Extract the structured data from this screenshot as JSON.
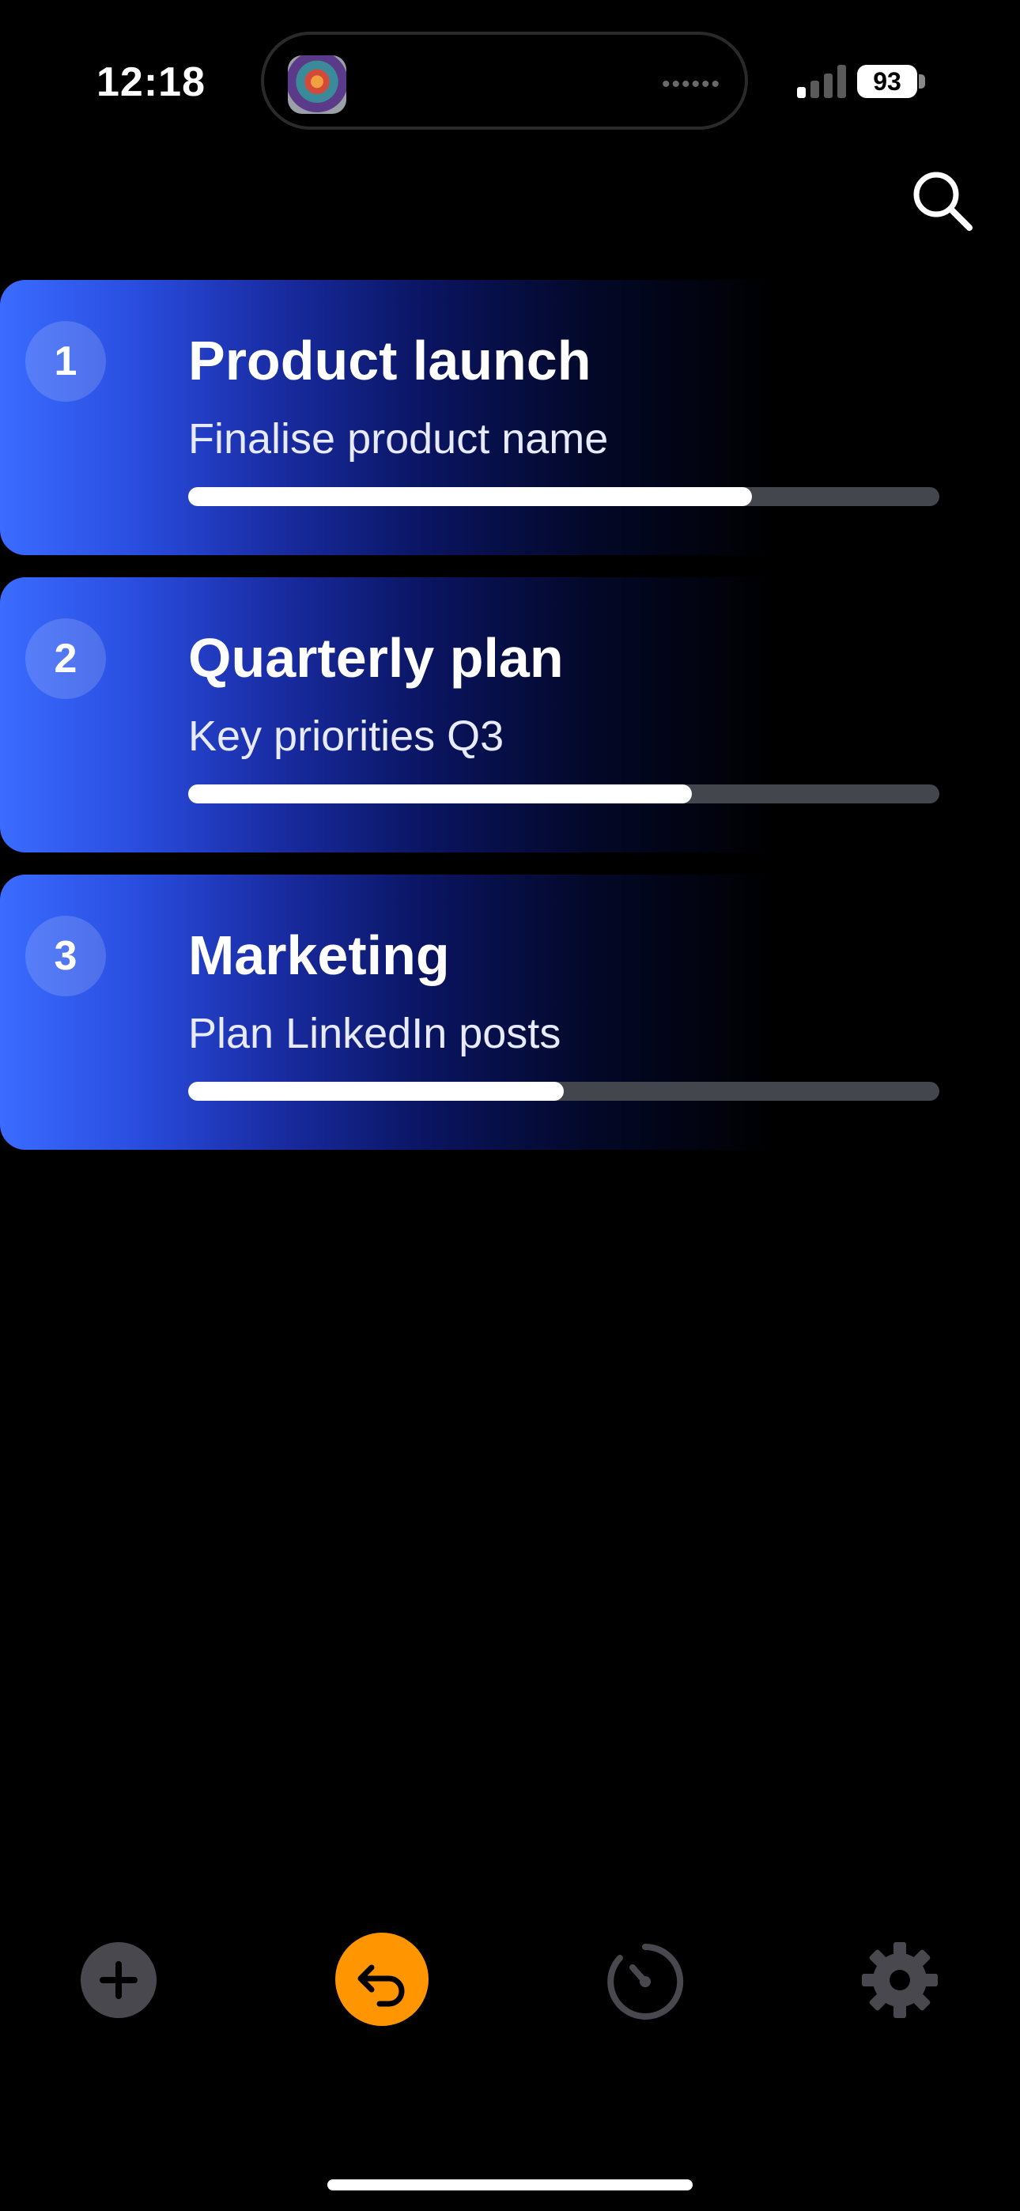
{
  "status_bar": {
    "time": "12:18",
    "battery": "93",
    "icons": [
      "app-icon",
      "signal-icon",
      "battery-icon"
    ]
  },
  "header": {
    "search_icon": "search-icon"
  },
  "cards": [
    {
      "number": "1",
      "title": "Product launch",
      "subtitle": "Finalise product name",
      "progress": 0.75
    },
    {
      "number": "2",
      "title": "Quarterly plan",
      "subtitle": "Key priorities Q3",
      "progress": 0.67
    },
    {
      "number": "3",
      "title": "Marketing",
      "subtitle": "Plan LinkedIn posts",
      "progress": 0.5
    }
  ],
  "bottom_nav": {
    "items": [
      "plus-icon",
      "undo-icon",
      "timer-icon",
      "gear-icon"
    ],
    "active_color": "#ff9500",
    "inactive_color": "#48484e"
  },
  "colors": {
    "card_gradient_start": "#3a6cff",
    "background": "#000000"
  }
}
